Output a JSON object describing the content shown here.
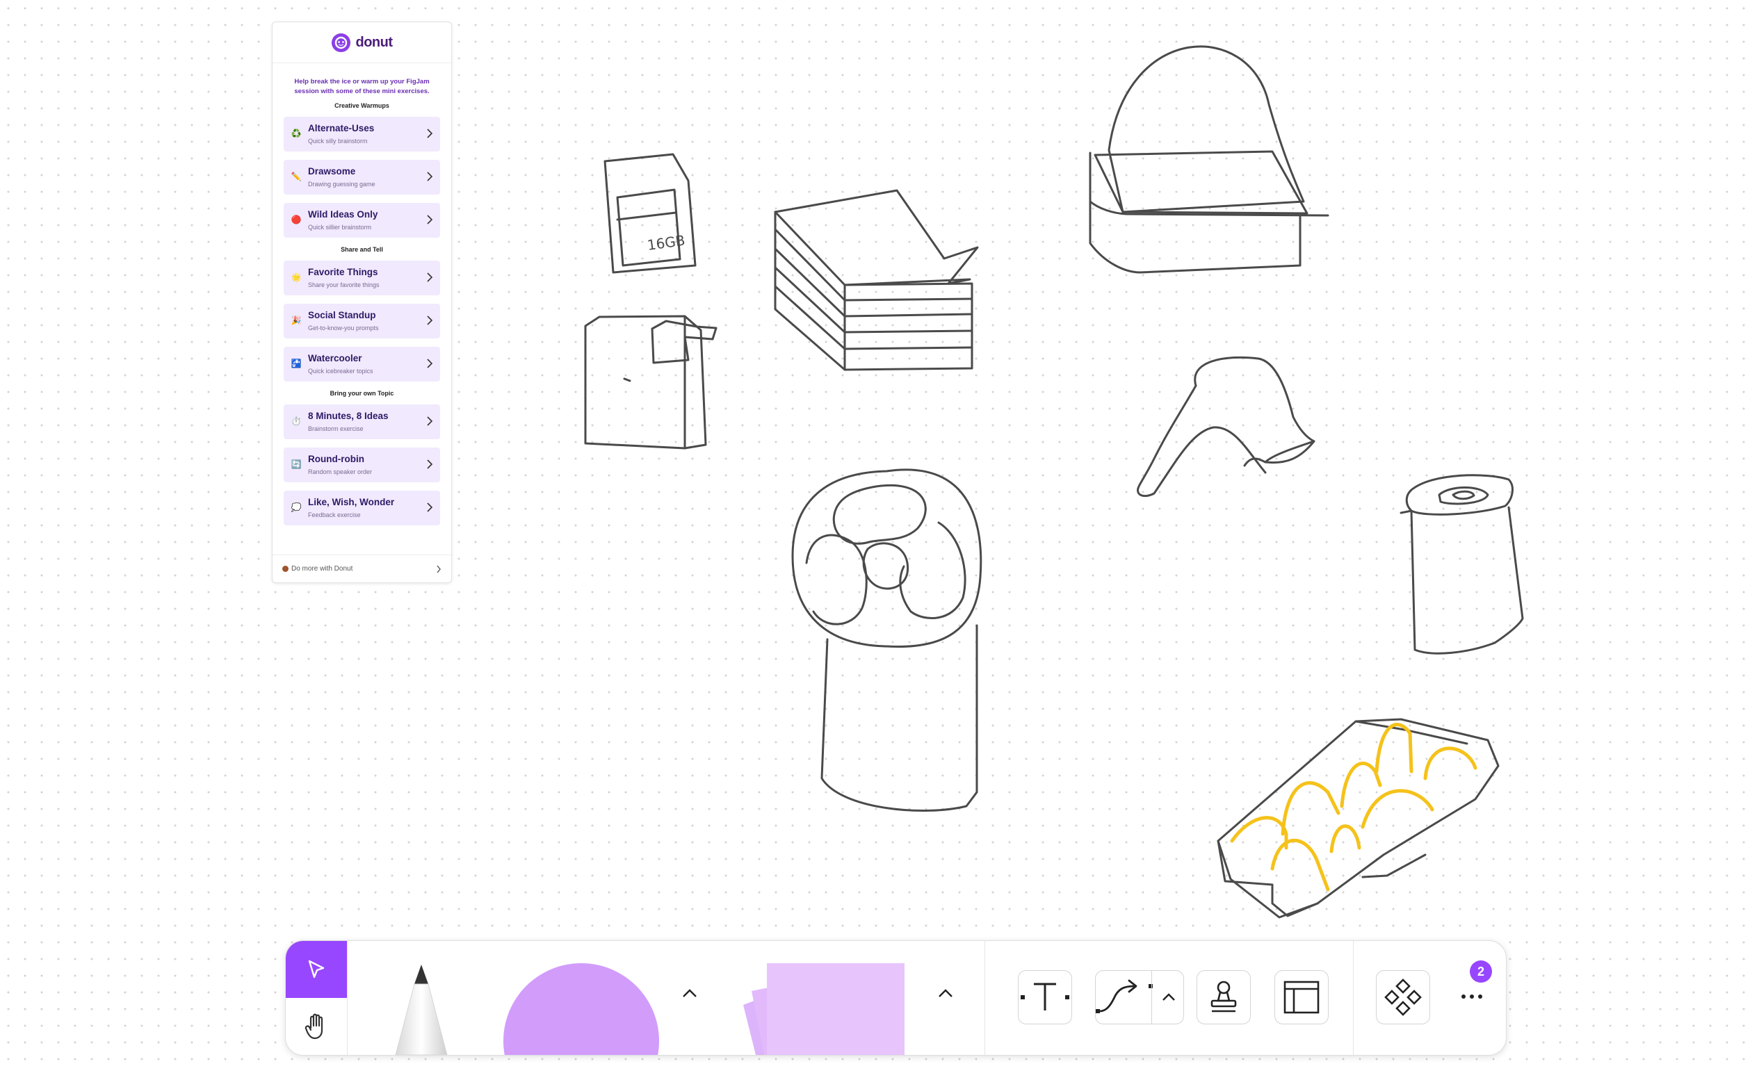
{
  "panel": {
    "brand": "donut",
    "intro": "Help break the ice or warm up your FigJam session with some of these mini exercises.",
    "sections": [
      {
        "label": "Creative Warmups",
        "items": [
          {
            "icon": "♻️",
            "title": "Alternate-Uses",
            "sub": "Quick silly brainstorm"
          },
          {
            "icon": "✏️",
            "title": "Drawsome",
            "sub": "Drawing guessing game"
          },
          {
            "icon": "🔴",
            "title": "Wild Ideas Only",
            "sub": "Quick sillier brainstorm"
          }
        ]
      },
      {
        "label": "Share and Tell",
        "items": [
          {
            "icon": "🌟",
            "title": "Favorite Things",
            "sub": "Share your favorite things"
          },
          {
            "icon": "🎉",
            "title": "Social Standup",
            "sub": "Get-to-know-you prompts"
          },
          {
            "icon": "🚰",
            "title": "Watercooler",
            "sub": "Quick icebreaker topics"
          }
        ]
      },
      {
        "label": "Bring your own Topic",
        "items": [
          {
            "icon": "⏱️",
            "title": "8 Minutes, 8 Ideas",
            "sub": "Brainstorm exercise"
          },
          {
            "icon": "🔄",
            "title": "Round-robin",
            "sub": "Random speaker order"
          },
          {
            "icon": "💭",
            "title": "Like, Wish, Wonder",
            "sub": "Feedback exercise"
          }
        ]
      }
    ],
    "footer": "Do more with Donut"
  },
  "canvas": {
    "sketch_label": "16GB"
  },
  "toolbar": {
    "badge": "2"
  },
  "colors": {
    "accent": "#9747ff",
    "sticky": "#e8c4fd",
    "shape": "#d29cfb",
    "panel_item": "#f1e9fd",
    "ink": "#4a4a4a",
    "highlighter": "#f5c21b"
  }
}
